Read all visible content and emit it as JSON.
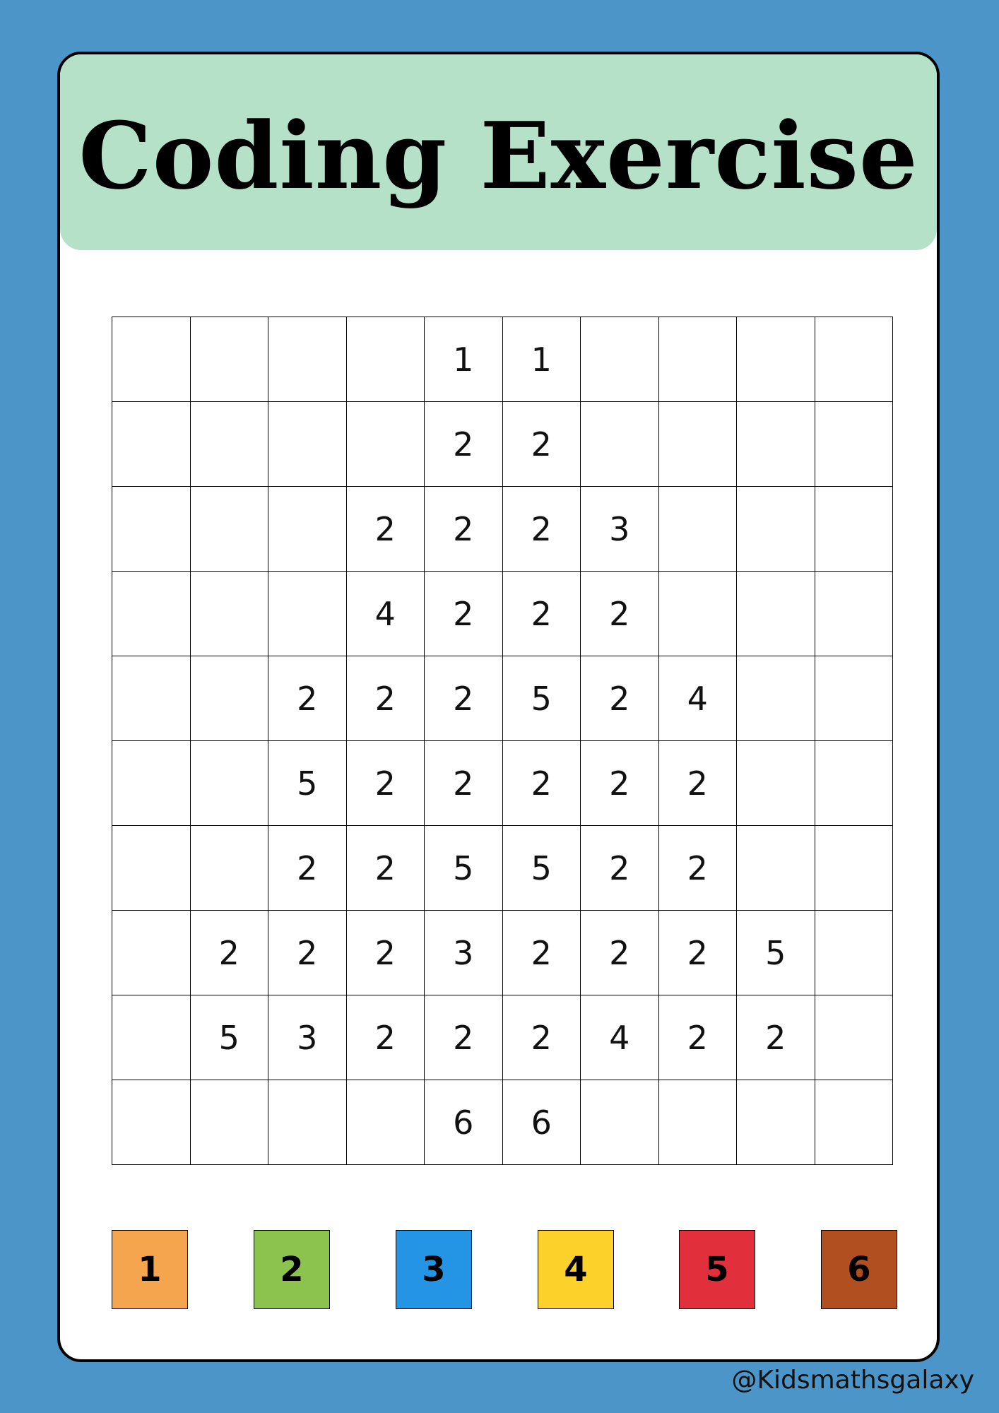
{
  "title": "Coding Exercise",
  "grid": {
    "rows": [
      [
        "",
        "",
        "",
        "",
        "1",
        "1",
        "",
        "",
        "",
        ""
      ],
      [
        "",
        "",
        "",
        "",
        "2",
        "2",
        "",
        "",
        "",
        ""
      ],
      [
        "",
        "",
        "",
        "2",
        "2",
        "2",
        "3",
        "",
        "",
        ""
      ],
      [
        "",
        "",
        "",
        "4",
        "2",
        "2",
        "2",
        "",
        "",
        ""
      ],
      [
        "",
        "",
        "2",
        "2",
        "2",
        "5",
        "2",
        "4",
        "",
        ""
      ],
      [
        "",
        "",
        "5",
        "2",
        "2",
        "2",
        "2",
        "2",
        "",
        ""
      ],
      [
        "",
        "",
        "2",
        "2",
        "5",
        "5",
        "2",
        "2",
        "",
        ""
      ],
      [
        "",
        "2",
        "2",
        "2",
        "3",
        "2",
        "2",
        "2",
        "5",
        ""
      ],
      [
        "",
        "5",
        "3",
        "2",
        "2",
        "2",
        "4",
        "2",
        "2",
        ""
      ],
      [
        "",
        "",
        "",
        "",
        "6",
        "6",
        "",
        "",
        "",
        ""
      ]
    ]
  },
  "legend": [
    {
      "label": "1",
      "color": "#f4a54e"
    },
    {
      "label": "2",
      "color": "#8bc34e"
    },
    {
      "label": "3",
      "color": "#2494e4"
    },
    {
      "label": "4",
      "color": "#fbd12a"
    },
    {
      "label": "5",
      "color": "#e1303c"
    },
    {
      "label": "6",
      "color": "#b24f20"
    }
  ],
  "footer": {
    "handle": "@Kidsmathsgalaxy"
  }
}
